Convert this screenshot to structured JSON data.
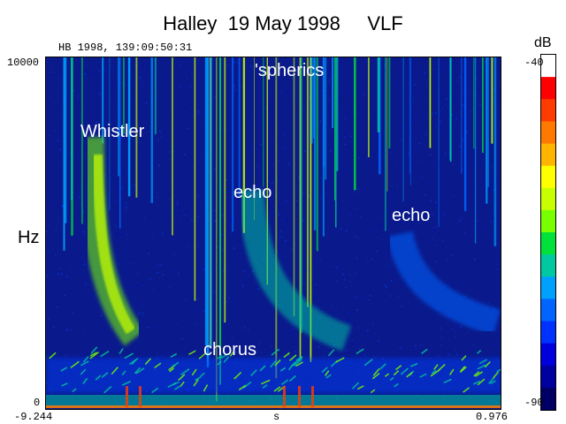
{
  "title": "Halley  19 May 1998     VLF",
  "timestamp": "HB 1998, 139:09:50:31",
  "chart_data": {
    "type": "heatmap",
    "title": "Halley  19 May 1998     VLF",
    "ylabel": "Hz",
    "xlabel": "s",
    "xlim": [
      -9.244,
      0.976
    ],
    "ylim": [
      0,
      10000
    ],
    "x_tick_labels": [
      "-9.244",
      "0.976"
    ],
    "y_tick_labels": [
      "0",
      "10000"
    ],
    "annotations": [
      "'spherics",
      "Whistler",
      "echo",
      "echo",
      "chorus"
    ],
    "colorbar": {
      "label": "dB",
      "range": [
        -90,
        -40
      ],
      "tick_labels": [
        "-40",
        "-90"
      ],
      "colors": [
        "#ffffff",
        "#ff0000",
        "#ff3c00",
        "#ff7800",
        "#ffb400",
        "#ffff00",
        "#c8ff00",
        "#78ff00",
        "#00e13c",
        "#00c8a0",
        "#00a0ff",
        "#0064ff",
        "#0032ff",
        "#0000dc",
        "#0000a0",
        "#000064"
      ]
    },
    "background_color": "#0a1a8c"
  }
}
